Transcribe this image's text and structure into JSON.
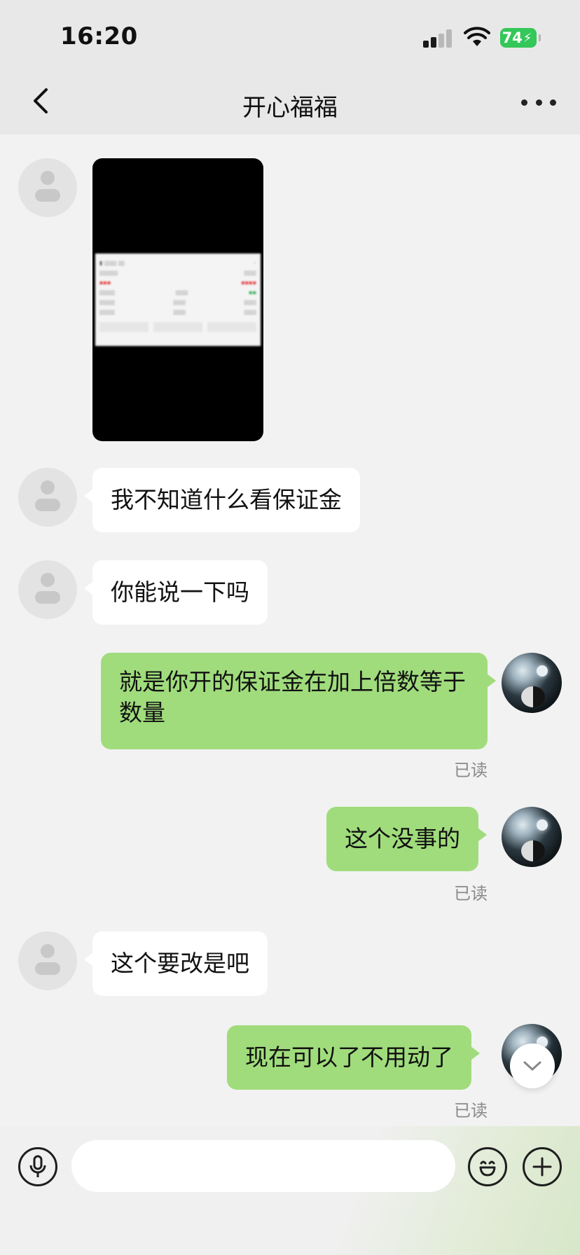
{
  "status_bar": {
    "time": "16:20",
    "battery": "74"
  },
  "header": {
    "title": "开心福福"
  },
  "messages": [
    {
      "side": "in",
      "type": "image"
    },
    {
      "side": "in",
      "type": "text",
      "text": "我不知道什么看保证金"
    },
    {
      "side": "in",
      "type": "text",
      "text": "你能说一下吗"
    },
    {
      "side": "out",
      "type": "text",
      "text": "就是你开的保证金在加上倍数等于数量",
      "status": "已读"
    },
    {
      "side": "out",
      "type": "text",
      "text": "这个没事的",
      "status": "已读"
    },
    {
      "side": "in",
      "type": "text",
      "text": "这个要改是吧"
    },
    {
      "side": "out",
      "type": "text",
      "text": "现在可以了不用动了",
      "status": "已读"
    }
  ],
  "input": {
    "placeholder": ""
  },
  "icons": [
    "back-icon",
    "more-icon",
    "voice-icon",
    "emoji-icon",
    "add-icon",
    "chevron-down-icon"
  ],
  "colors": {
    "outgoing_bubble": "#a0dc7c",
    "incoming_bubble": "#ffffff",
    "background": "#f2f2f2",
    "battery": "#34c759"
  }
}
